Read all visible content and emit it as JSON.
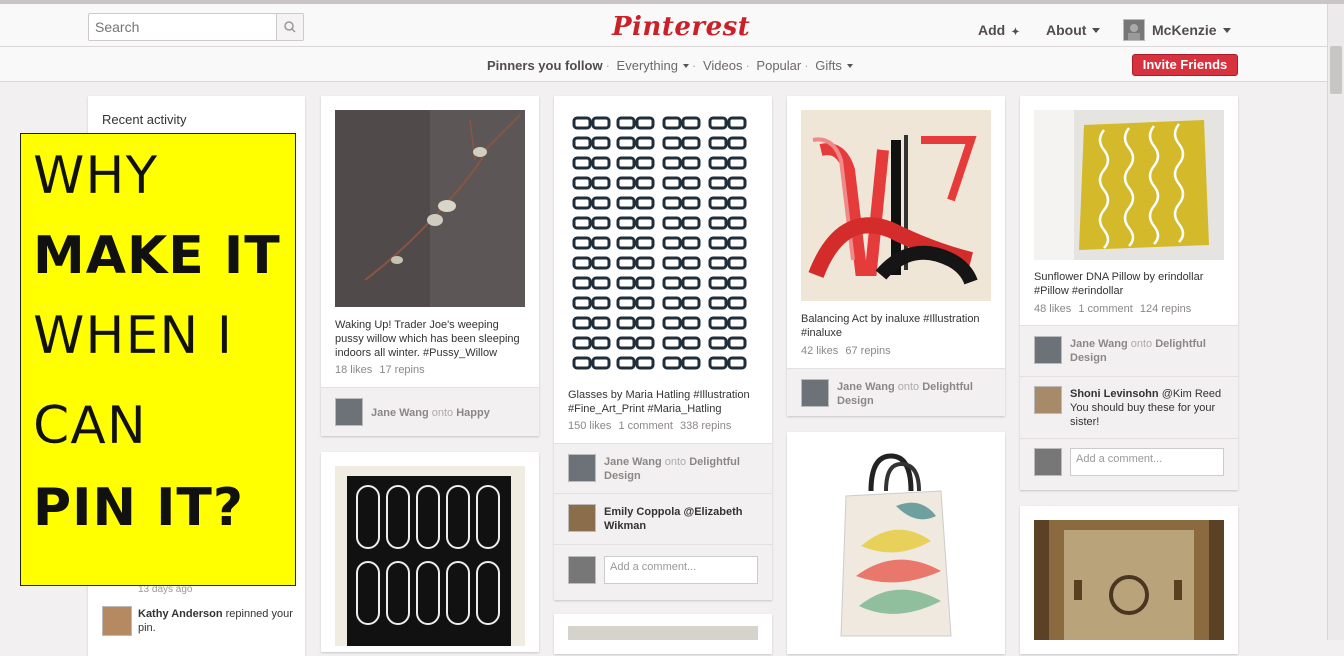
{
  "header": {
    "search_placeholder": "Search",
    "logo": "Pinterest",
    "add": "Add",
    "about": "About",
    "user": "McKenzie"
  },
  "subnav": {
    "items": [
      "Pinners you follow",
      "Everything",
      "Videos",
      "Popular",
      "Gifts"
    ],
    "invite": "Invite Friends"
  },
  "sidebar": {
    "title": "Recent activity",
    "time": "13 days ago",
    "activity_user": "Kathy Anderson",
    "activity_text": "repinned your pin."
  },
  "overlay": {
    "lines": [
      "WHY",
      "MAKE IT",
      "WHEN I",
      "CAN",
      "PIN IT?"
    ]
  },
  "pins": {
    "p1": {
      "desc": "Waking Up! Trader Joe's weeping pussy willow which has been sleeping indoors all winter. #Pussy_Willow",
      "likes": "18 likes",
      "repins": "17 repins",
      "act_user": "Jane Wang",
      "act_onto": "onto",
      "act_board": "Happy"
    },
    "p2": {
      "desc": "Glasses by Maria Hatling #Illustration #Fine_Art_Print #Maria_Hatling",
      "likes": "150 likes",
      "comments": "1 comment",
      "repins": "338 repins",
      "act_user": "Jane Wang",
      "act_onto": "onto",
      "act_board": "Delightful Design",
      "c_user": "Emily Coppola",
      "c_text": "@Elizabeth Wikman",
      "comment_placeholder": "Add a comment..."
    },
    "p3": {
      "desc": "Balancing Act by inaluxe #Illustration #inaluxe",
      "likes": "42 likes",
      "repins": "67 repins",
      "act_user": "Jane Wang",
      "act_onto": "onto",
      "act_board": "Delightful Design"
    },
    "p4": {
      "desc": "Sunflower DNA Pillow by erindollar #Pillow #erindollar",
      "likes": "48 likes",
      "comments": "1 comment",
      "repins": "124 repins",
      "act_user": "Jane Wang",
      "act_onto": "onto",
      "act_board": "Delightful Design",
      "c_user": "Shoni Levinsohn",
      "c_text": "@Kim Reed You should buy these for your sister!",
      "comment_placeholder": "Add a comment..."
    }
  },
  "colors": {
    "brand": "#cb2027",
    "overlay": "#ffff00"
  }
}
